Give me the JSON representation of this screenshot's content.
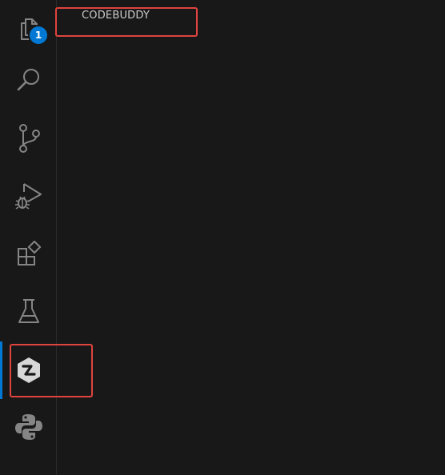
{
  "activity_bar": {
    "items": [
      {
        "name": "explorer",
        "icon": "files-icon",
        "badge": "1",
        "active": false
      },
      {
        "name": "search",
        "icon": "search-icon",
        "active": false
      },
      {
        "name": "source-control",
        "icon": "source-control-icon",
        "active": false
      },
      {
        "name": "run-and-debug",
        "icon": "run-debug-icon",
        "active": false
      },
      {
        "name": "extensions",
        "icon": "extensions-icon",
        "active": false
      },
      {
        "name": "testing",
        "icon": "flask-icon",
        "active": false
      },
      {
        "name": "codebuddy",
        "icon": "codebuddy-icon",
        "active": true
      },
      {
        "name": "python",
        "icon": "python-icon",
        "active": false
      }
    ]
  },
  "side_panel": {
    "title": "CODEBUDDY"
  },
  "colors": {
    "background": "#181818",
    "icon": "#858585",
    "active_icon": "#d7d7d7",
    "accent": "#0078d4",
    "highlight": "#e0443e"
  }
}
